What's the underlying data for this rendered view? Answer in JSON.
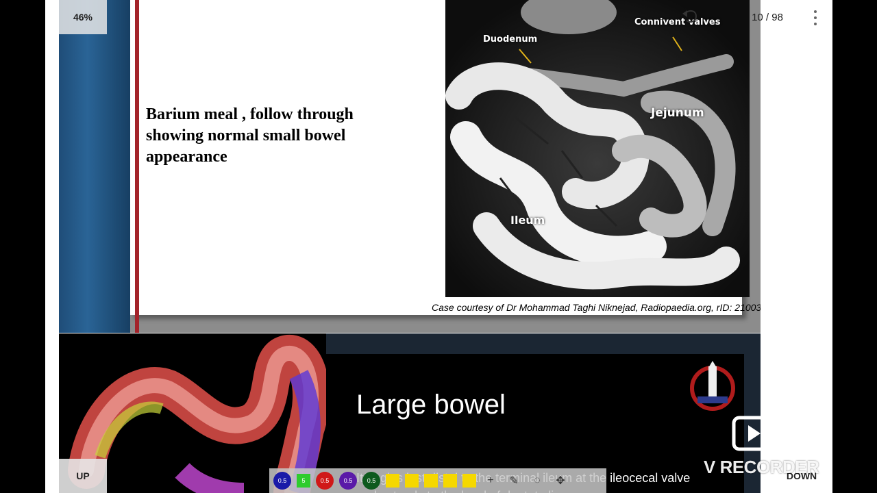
{
  "viewer": {
    "zoom_label": "46%",
    "page_indicator": "10 / 98",
    "up_label": "UP",
    "down_label": "DOWN"
  },
  "slide1": {
    "title": "Barium meal , follow through showing normal small bowel appearance",
    "labels": {
      "duodenum": "Duodenum",
      "connivent": "Connivent valves",
      "jejunum": "Jejunum",
      "ileum": "Ileum"
    },
    "caption": "Case courtesy of Dr Mohammad Taghi Niknejad, Radiopaedia.org, rID: 21003"
  },
  "slide2": {
    "title": "Large bowel",
    "body": "It begins just distal to the terminal ileum at the ileocecal valve and extends to the level of dentate line"
  },
  "toolbar": {
    "items": [
      {
        "label": "0.5",
        "color": "#1a1aa8"
      },
      {
        "label": "5",
        "color": "#2ecc2e"
      },
      {
        "label": "0.5",
        "color": "#d01818"
      },
      {
        "label": "0.5",
        "color": "#5a1aa8"
      },
      {
        "label": "0.5",
        "color": "#0e5a1e"
      }
    ],
    "square_color": "#f5d800"
  },
  "watermark": {
    "text": "V RECORDER"
  },
  "colors": {
    "slide_blue": "#1f4d78",
    "slide_red": "#a3232a"
  }
}
